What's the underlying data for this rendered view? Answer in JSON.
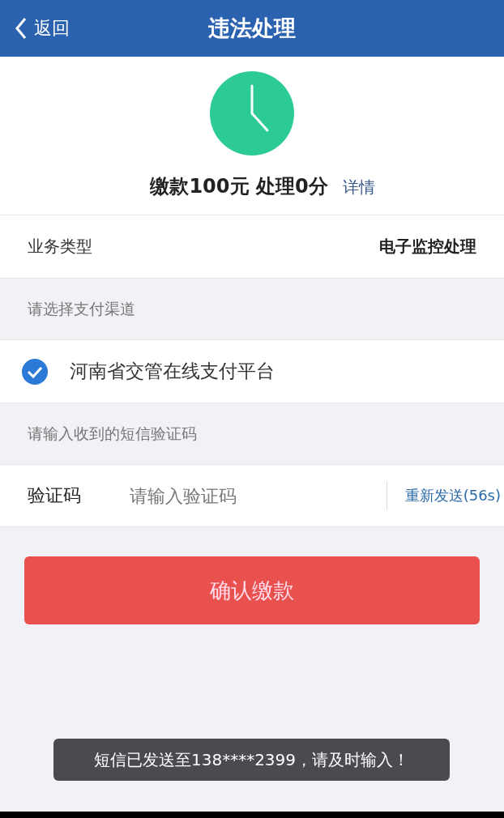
{
  "header": {
    "back": "返回",
    "title": "违法处理"
  },
  "summary": {
    "text": "缴款100元 处理0分",
    "link": "详情"
  },
  "business": {
    "label": "业务类型",
    "value": "电子监控处理"
  },
  "payment": {
    "heading": "请选择支付渠道",
    "options": [
      {
        "label": "河南省交管在线支付平台",
        "selected": true
      }
    ]
  },
  "verify": {
    "heading": "请输入收到的短信验证码",
    "label": "验证码",
    "placeholder": "请输入验证码",
    "resend": "重新发送(56s)"
  },
  "confirm": "确认缴款",
  "toast": "短信已发送至138****2399，请及时输入！"
}
